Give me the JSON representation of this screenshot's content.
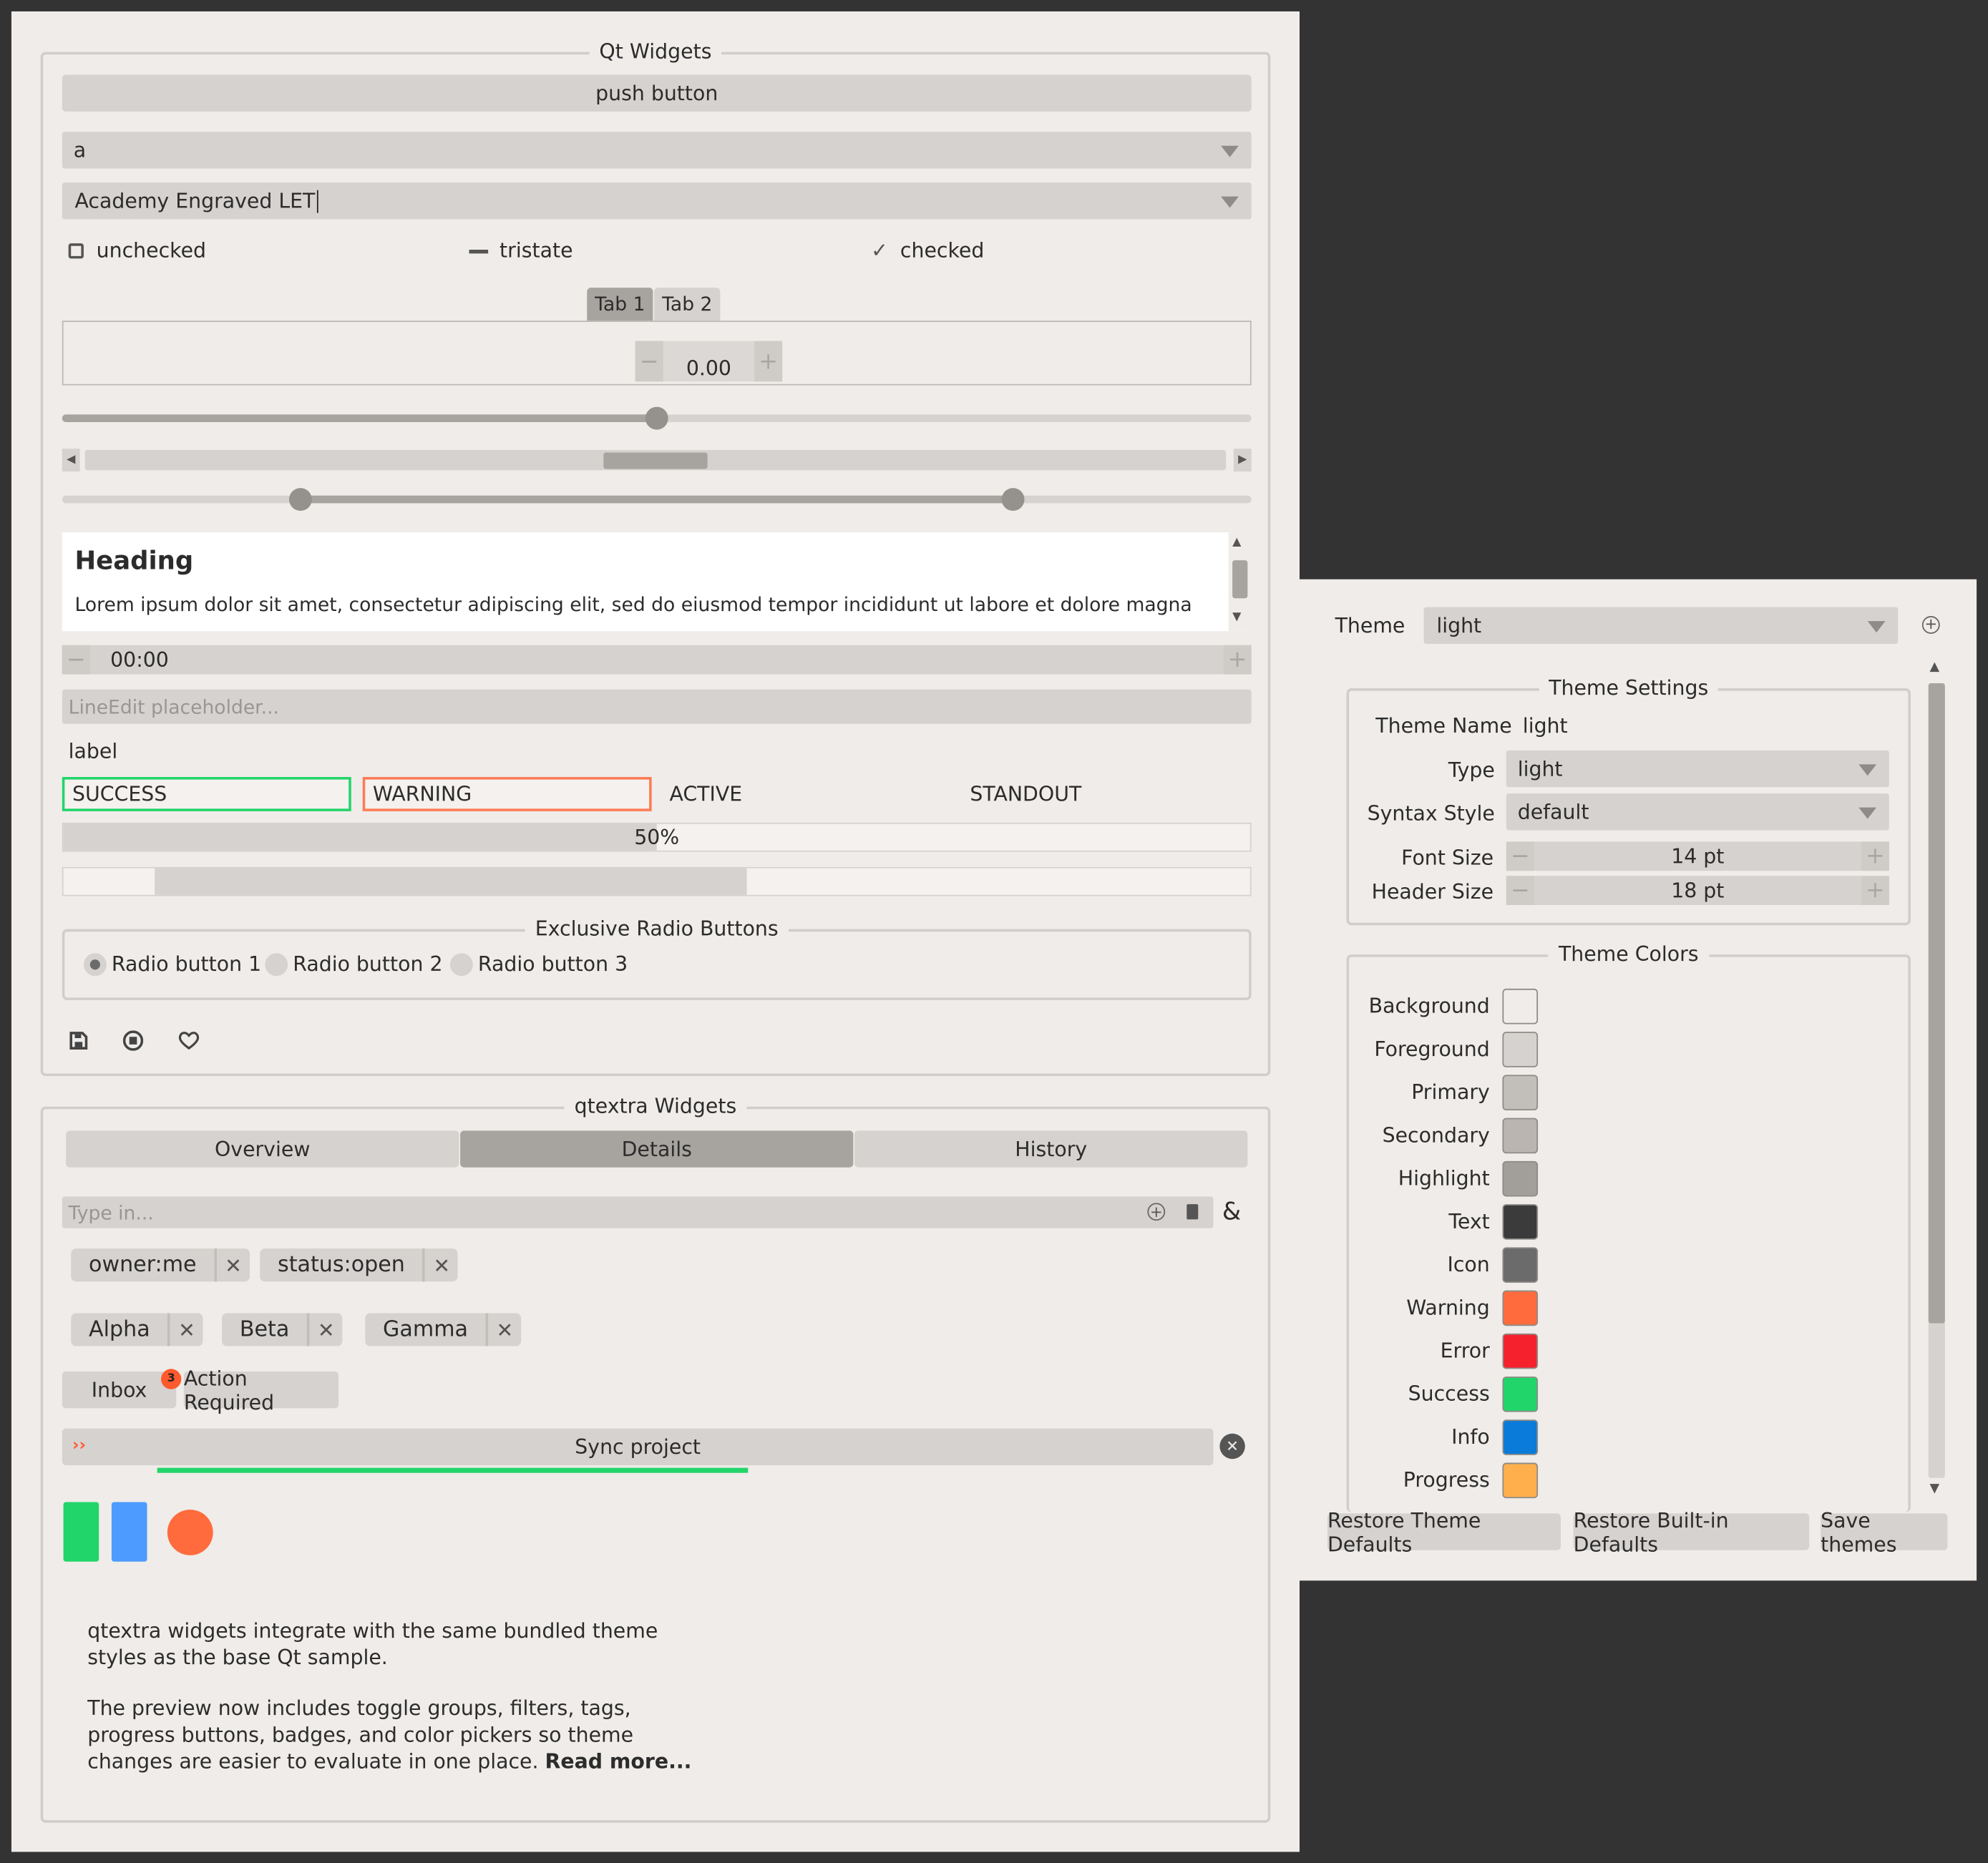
{
  "qt": {
    "group_title": "Qt Widgets",
    "push_button": "push button",
    "combo_value": "a",
    "font_combo_value": "Academy Engraved LET",
    "check_unchecked": "unchecked",
    "check_tristate": "tristate",
    "check_checked": "checked",
    "tab1": "Tab 1",
    "tab2": "Tab 2",
    "spin_value": "0.00",
    "slider_value": 0.5,
    "scroll_value": 0.5,
    "range_low": 0.2,
    "range_high": 0.8,
    "heading": "Heading",
    "body_text": "Lorem ipsum dolor sit amet, consectetur adipiscing elit, sed do eiusmod tempor incididunt ut labore et dolore magna",
    "time_value": "00:00",
    "lineedit_placeholder": "LineEdit placeholder...",
    "label": "label",
    "success": "SUCCESS",
    "warning": "WARNING",
    "active": "ACTIVE",
    "standout": "STANDOUT",
    "progress_text": "50%",
    "progress_value": 0.5,
    "radio_group_title": "Exclusive Radio Buttons",
    "radio1": "Radio button 1",
    "radio2": "Radio button 2",
    "radio3": "Radio button 3"
  },
  "qtextra": {
    "group_title": "qtextra Widgets",
    "toggle": [
      "Overview",
      "Details",
      "History"
    ],
    "toggle_selected": 1,
    "filter_placeholder": "Type in...",
    "filter_mode": "&",
    "filters": [
      "owner:me",
      "status:open"
    ],
    "tags": [
      "Alpha",
      "Beta",
      "Gamma"
    ],
    "badge_button": "Inbox",
    "badge_count": "3",
    "action_button": "Action Required",
    "sync_button": "Sync project",
    "info_line1": "qtextra widgets integrate with the same bundled theme",
    "info_line2": "styles as the base Qt sample.",
    "info_line3": "The preview now includes toggle groups, filters, tags,",
    "info_line4": "progress buttons, badges, and color pickers so theme",
    "info_line5": "changes are easier to evaluate in one place.",
    "info_link": "Read more..."
  },
  "theme": {
    "label": "Theme",
    "value": "light",
    "settings_title": "Theme Settings",
    "name_label": "Theme Name",
    "name_value": "light",
    "type_label": "Type",
    "type_value": "light",
    "syntax_label": "Syntax Style",
    "syntax_value": "default",
    "font_label": "Font Size",
    "font_value": "14 pt",
    "header_label": "Header Size",
    "header_value": "18 pt",
    "colors_title": "Theme Colors",
    "colors": [
      {
        "name": "Background",
        "hex": "#efece9"
      },
      {
        "name": "Foreground",
        "hex": "#d6d2cf"
      },
      {
        "name": "Primary",
        "hex": "#c2beba"
      },
      {
        "name": "Secondary",
        "hex": "#bab5b1"
      },
      {
        "name": "Highlight",
        "hex": "#a29e9a"
      },
      {
        "name": "Text",
        "hex": "#3b3b3b"
      },
      {
        "name": "Icon",
        "hex": "#6b6b6b"
      },
      {
        "name": "Warning",
        "hex": "#ff6b3d"
      },
      {
        "name": "Error",
        "hex": "#f5222d"
      },
      {
        "name": "Success",
        "hex": "#22d56a"
      },
      {
        "name": "Info",
        "hex": "#0a7bd8"
      },
      {
        "name": "Progress",
        "hex": "#ffb04d"
      }
    ],
    "restore_theme": "Restore Theme Defaults",
    "restore_builtin": "Restore Built-in Defaults",
    "save": "Save themes"
  },
  "colors": {
    "success": "#22d56a",
    "warning": "#ff6b3d",
    "info": "#3c9bff"
  }
}
